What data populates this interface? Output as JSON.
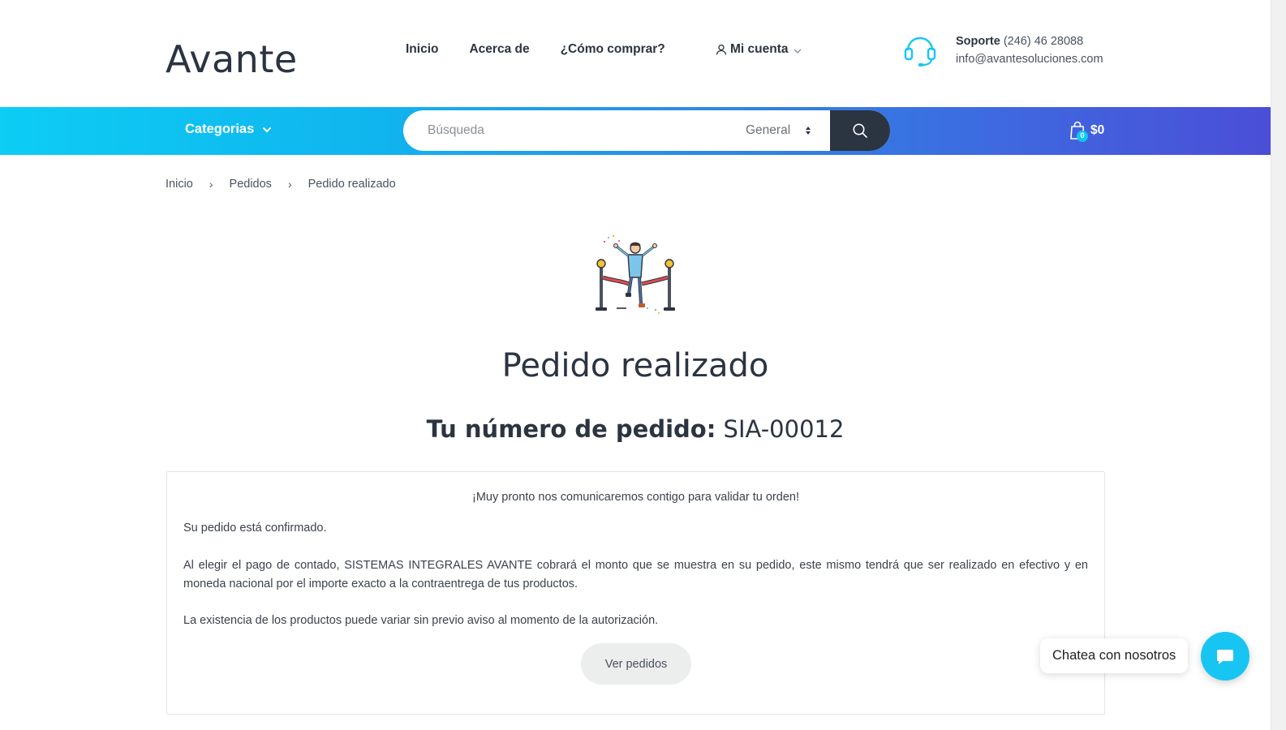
{
  "brand": {
    "logo_text": "Avante"
  },
  "nav": {
    "items": [
      "Inicio",
      "Acerca de",
      "¿Cómo comprar?"
    ]
  },
  "account": {
    "label": "Mi cuenta"
  },
  "support": {
    "label": "Soporte",
    "phone": "(246) 46 28088",
    "email": "info@avantesoluciones.com"
  },
  "toolbar": {
    "categories_label": "Categorias",
    "search_placeholder": "Búsqueda",
    "search_scope": "General",
    "cart_count": "0",
    "cart_total": "$0"
  },
  "breadcrumb": [
    "Inicio",
    "Pedidos",
    "Pedido realizado"
  ],
  "page": {
    "title": "Pedido realizado",
    "order_label": "Tu número de pedido:",
    "order_number": "SIA-00012",
    "lead": "¡Muy pronto nos comunicaremos contigo para validar tu orden!",
    "p1": "Su pedido está confirmado.",
    "p2": "Al elegir el pago de contado, SISTEMAS INTEGRALES AVANTE cobrará el monto que se muestra en su pedido, este mismo tendrá que ser realizado en efectivo y en moneda nacional por el importe exacto a la contraentrega de tus productos.",
    "p3": "La existencia de los productos puede variar sin previo aviso al momento de la autorización.",
    "button": "Ver pedidos"
  },
  "chat": {
    "label": "Chatea con nosotros"
  },
  "colors": {
    "accent": "#0dcdf4",
    "gradient_end": "#4b4ed8",
    "dark": "#2b3441"
  }
}
